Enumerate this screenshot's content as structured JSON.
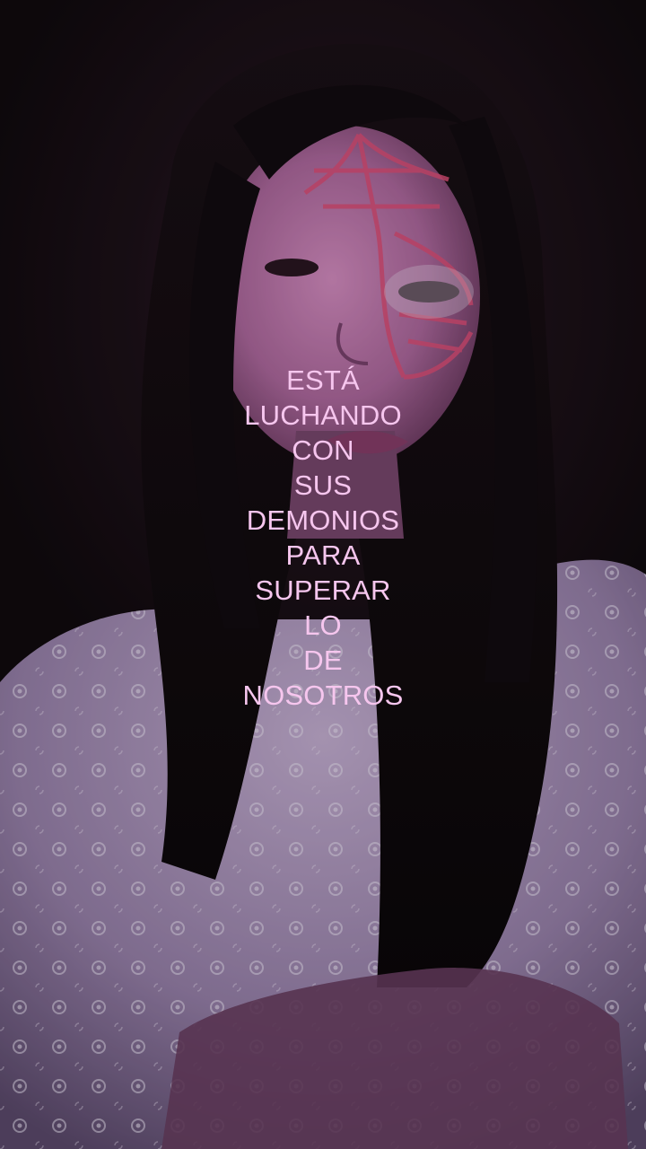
{
  "caption": {
    "lines": [
      "ESTÁ",
      "LUCHANDO",
      "CON",
      "SUS",
      "DEMONIOS",
      "PARA",
      "SUPERAR",
      "LO",
      "DE",
      "NOSOTROS"
    ]
  },
  "colors": {
    "caption_text": "#f6c6ee",
    "background": "#120b10",
    "face_paint": "#e0507a",
    "blouse": "#b9a3c7"
  }
}
